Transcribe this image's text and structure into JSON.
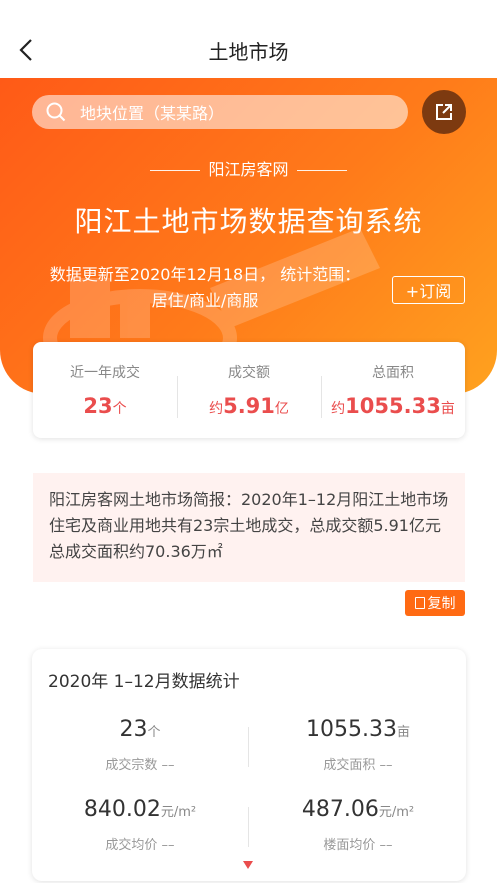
{
  "nav": {
    "title": "土地市场"
  },
  "search": {
    "placeholder": "地块位置（某某路）"
  },
  "hero": {
    "brand": "阳江房客网",
    "title": "阳江土地市场数据查询系统",
    "update_line1": "数据更新至2020年12月18日，  统计范围：",
    "update_line2": "居住/商业/商服",
    "subscribe": "+订阅"
  },
  "summary": {
    "items": [
      {
        "label": "近一年成交",
        "prefix": "",
        "value": "23",
        "unit": "个"
      },
      {
        "label": "成交额",
        "prefix": "约",
        "value": "5.91",
        "unit": "亿"
      },
      {
        "label": "总面积",
        "prefix": "约",
        "value": "1055.33",
        "unit": "亩"
      }
    ]
  },
  "brief": {
    "text": "阳江房客网土地市场简报：2020年1–12月阳江土地市场住宅及商业用地共有23宗土地成交，总成交额5.91亿元总成交面积约70.36万㎡",
    "copy": "复制"
  },
  "stats": {
    "title": "2020年 1–12月数据统计",
    "items": [
      {
        "value": "23",
        "unit": "个",
        "caption": "成交宗数 ––"
      },
      {
        "value": "1055.33",
        "unit": "亩",
        "caption": "成交面积 ––"
      },
      {
        "value": "840.02",
        "unit": "元/m²",
        "caption": "成交均价 ––"
      },
      {
        "value": "487.06",
        "unit": "元/m²",
        "caption": "楼面均价 ––"
      }
    ]
  },
  "colors": {
    "accent": "#ff6a13",
    "value_red": "#ea4d4d",
    "share_bg": "#7d3a10"
  }
}
